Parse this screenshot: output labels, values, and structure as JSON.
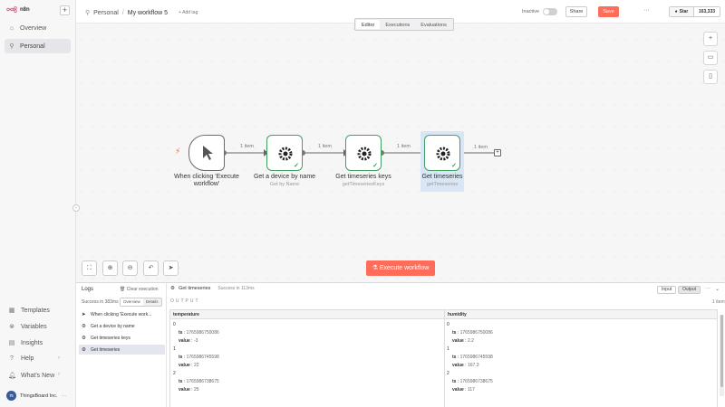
{
  "app": {
    "logo_text": "n8n"
  },
  "sidebar": {
    "items": [
      {
        "label": "Overview",
        "icon": "home-icon"
      },
      {
        "label": "Personal",
        "icon": "user-icon"
      }
    ],
    "bottom": [
      {
        "label": "Templates"
      },
      {
        "label": "Variables"
      },
      {
        "label": "Insights"
      },
      {
        "label": "Help"
      },
      {
        "label": "What's New"
      }
    ],
    "user": {
      "initials": "TI",
      "name": "ThingsBoard Inc."
    }
  },
  "header": {
    "breadcrumb_project": "Personal",
    "separator": "/",
    "workflow_title": "My workflow 5",
    "add_tag": "+ Add tag",
    "status_label": "Inactive",
    "share_label": "Share",
    "save_label": "Save",
    "star_label": "Star",
    "star_count": "163,333"
  },
  "canvas": {
    "tabs": [
      "Editor",
      "Executions",
      "Evaluations"
    ],
    "nodes": [
      {
        "title": "When clicking 'Execute workflow'",
        "subtitle": ""
      },
      {
        "title": "Get a device by name",
        "subtitle": "Get by Name"
      },
      {
        "title": "Get timeseries keys",
        "subtitle": "getTimeseriesKeys"
      },
      {
        "title": "Get timeseries",
        "subtitle": "getTimeseries"
      }
    ],
    "connection_label": "1 item",
    "execute_label": "Execute workflow",
    "accent": "#ff6d5a",
    "node_border": "#43a063"
  },
  "logs": {
    "title": "Logs",
    "clear_label": "Clear execution",
    "success_text": "Success in 383ms",
    "view_tabs": [
      "Overview",
      "Details"
    ],
    "entries": [
      {
        "label": "When clicking 'Execute work..."
      },
      {
        "label": "Get a device by name"
      },
      {
        "label": "Get timeseries keys"
      },
      {
        "label": "Get timeseries"
      }
    ]
  },
  "output": {
    "node_name": "Get timeseries",
    "success_text": "Success in 113ms",
    "input_label": "Input",
    "output_label": "Output",
    "section_label": "OUTPUT",
    "item_count": "1 item",
    "columns": [
      "temperature",
      "humidity"
    ],
    "temperature": [
      {
        "idx": "0",
        "ts": "1765986750086",
        "value": "-3"
      },
      {
        "idx": "1",
        "ts": "1765986745598",
        "value": "22"
      },
      {
        "idx": "2",
        "ts": "1765986738675",
        "value": "25"
      }
    ],
    "humidity": [
      {
        "idx": "0",
        "ts": "1765986750086",
        "value": "2.2"
      },
      {
        "idx": "1",
        "ts": "1765986745598",
        "value": "167.3"
      },
      {
        "idx": "2",
        "ts": "1765986738675",
        "value": "117"
      }
    ]
  }
}
